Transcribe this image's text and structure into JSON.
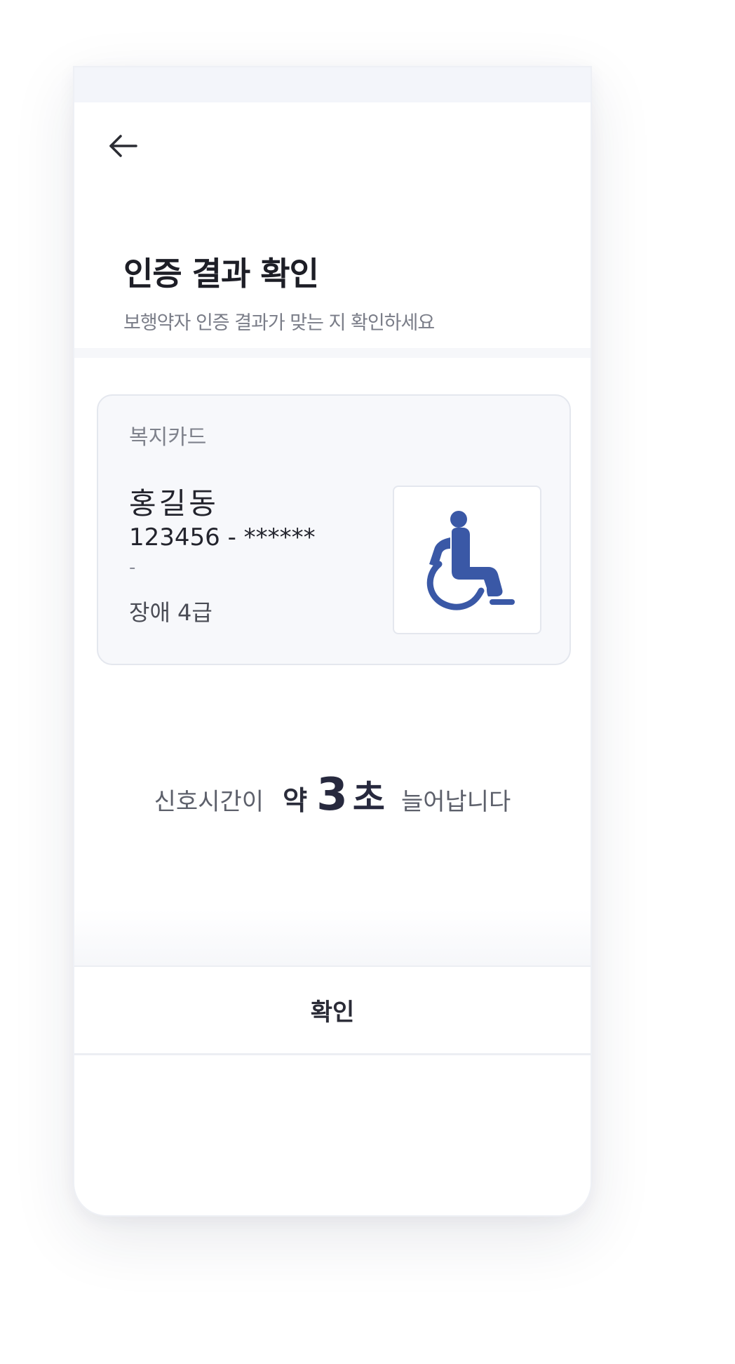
{
  "header": {
    "title": "인증 결과 확인",
    "subtitle": "보행약자 인증 결과가 맞는 지 확인하세요",
    "back_icon": "arrow-left-icon"
  },
  "card": {
    "type_label": "복지카드",
    "holder_name": "홍길동",
    "id_number": "123456 - ******",
    "extra_line": "-",
    "disability_grade": "장애  4급",
    "icon": "wheelchair-icon",
    "icon_color": "#3a58a6"
  },
  "signal_extension": {
    "prefix": "신호시간이",
    "about": "약",
    "seconds": "3",
    "unit": "초",
    "suffix": "늘어납니다"
  },
  "confirm_button": {
    "label": "확인"
  }
}
